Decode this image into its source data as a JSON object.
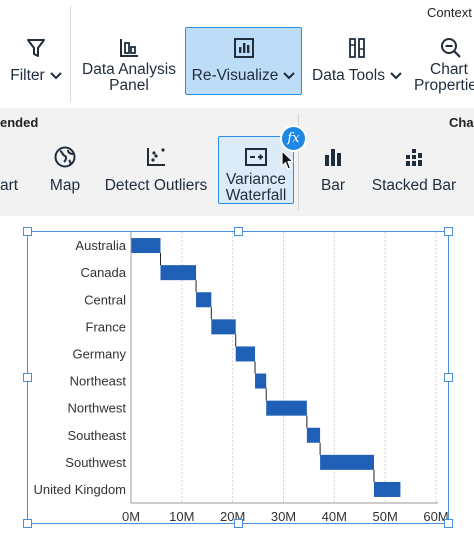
{
  "toolbar": {
    "context_label": "Context",
    "filter_label": "Filter",
    "data_analysis_panel_line1": "Data Analysis",
    "data_analysis_panel_line2": "Panel",
    "revisualize_label": "Re-Visualize",
    "data_tools_label": "Data Tools",
    "chart_properties_line1": "Chart",
    "chart_properties_line2": "Properties"
  },
  "ribbon": {
    "section_recommended": "ended",
    "section_charts": "Cha",
    "items": {
      "chart_partial": "art",
      "map": "Map",
      "detect_outliers": "Detect Outliers",
      "variance_waterfall_line1": "Variance",
      "variance_waterfall_line2": "Waterfall",
      "bar": "Bar",
      "stacked_bar": "Stacked Bar"
    },
    "fx_badge": "fx"
  },
  "colors": {
    "bar": "#1f5fb5",
    "accent": "#2f8ee0",
    "active_bg": "#bcdcf7"
  },
  "chart_data": {
    "type": "bar",
    "orientation": "horizontal",
    "subtype": "waterfall",
    "categories": [
      "Australia",
      "Canada",
      "Central",
      "France",
      "Germany",
      "Northeast",
      "Northwest",
      "Southeast",
      "Southwest",
      "United Kingdom"
    ],
    "start": [
      0,
      5.8,
      12.8,
      15.8,
      20.6,
      24.4,
      26.6,
      34.6,
      37.2,
      47.8
    ],
    "end": [
      5.8,
      12.8,
      15.8,
      20.6,
      24.4,
      26.6,
      34.6,
      37.2,
      47.8,
      53.0
    ],
    "xticks": [
      "0M",
      "10M",
      "20M",
      "30M",
      "40M",
      "50M",
      "60M"
    ],
    "xlim": [
      0,
      60
    ],
    "grid": true
  }
}
